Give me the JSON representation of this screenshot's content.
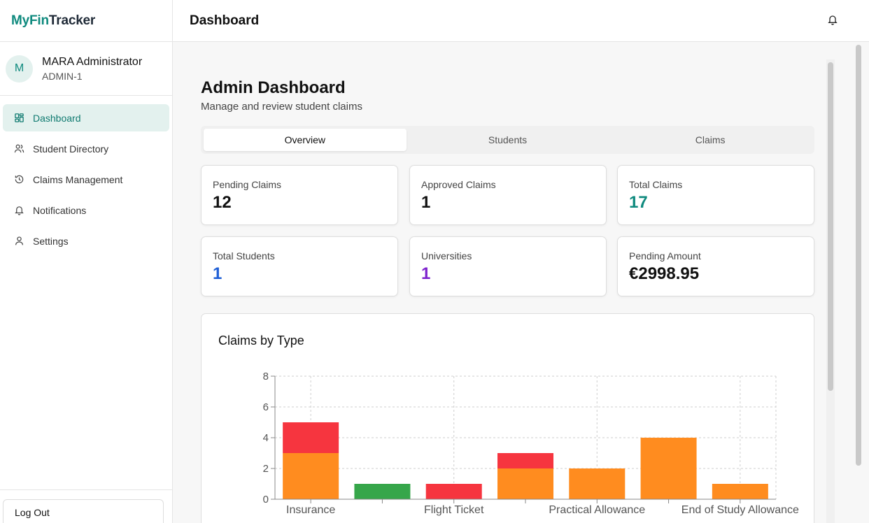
{
  "app": {
    "brand_part1": "My",
    "brand_part2": "Fin",
    "brand_part3": "Tracker"
  },
  "user": {
    "initial": "M",
    "name": "MARA Administrator",
    "id": "ADMIN-1"
  },
  "sidebar": {
    "items": [
      {
        "label": "Dashboard",
        "icon": "dashboard-icon",
        "active": true
      },
      {
        "label": "Student Directory",
        "icon": "users-icon"
      },
      {
        "label": "Claims Management",
        "icon": "history-icon"
      },
      {
        "label": "Notifications",
        "icon": "bell-icon"
      },
      {
        "label": "Settings",
        "icon": "user-icon"
      }
    ],
    "logout_label": "Log Out"
  },
  "header": {
    "title": "Dashboard",
    "icon": "bell-icon"
  },
  "page": {
    "title": "Admin Dashboard",
    "subtitle": "Manage and review student claims"
  },
  "tabs": [
    {
      "label": "Overview",
      "active": true
    },
    {
      "label": "Students"
    },
    {
      "label": "Claims"
    }
  ],
  "stats": [
    {
      "label": "Pending Claims",
      "value": "12",
      "color": "#111111"
    },
    {
      "label": "Approved Claims",
      "value": "1",
      "color": "#111111"
    },
    {
      "label": "Total Claims",
      "value": "17",
      "color": "#0f8a7e"
    },
    {
      "label": "Total Students",
      "value": "1",
      "color": "#1f5fd6"
    },
    {
      "label": "Universities",
      "value": "1",
      "color": "#7e22ce"
    },
    {
      "label": "Pending Amount",
      "value": "€2998.95",
      "color": "#111111"
    }
  ],
  "chart_title": "Claims by Type",
  "chart_data": {
    "type": "bar",
    "stacked": true,
    "categories": [
      "Insurance",
      "",
      "Flight Ticket",
      "",
      "Practical Allowance",
      "",
      "End of Study Allowance"
    ],
    "series": [
      {
        "color": "#ff8c1f",
        "values": [
          3,
          0,
          0,
          2,
          2,
          4,
          1
        ]
      },
      {
        "color": "#36a64a",
        "values": [
          0,
          1,
          0,
          0,
          0,
          0,
          0
        ]
      },
      {
        "color": "#f6353f",
        "values": [
          2,
          0,
          1,
          1,
          0,
          0,
          0
        ]
      }
    ],
    "ylim": [
      0,
      8
    ],
    "yticks": [
      0,
      2,
      4,
      6,
      8
    ],
    "grid": true
  }
}
